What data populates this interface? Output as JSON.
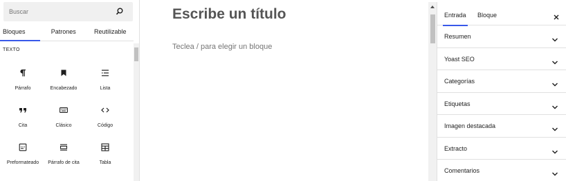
{
  "inserter": {
    "search": {
      "placeholder": "Buscar"
    },
    "tabs": [
      {
        "label": "Bloques",
        "active": true
      },
      {
        "label": "Patrones",
        "active": false
      },
      {
        "label": "Reutilizable",
        "active": false
      }
    ],
    "section": "TEXTO",
    "blocks": [
      {
        "label": "Párrafo",
        "icon": "paragraph-icon"
      },
      {
        "label": "Encabezado",
        "icon": "bookmark-icon"
      },
      {
        "label": "Lista",
        "icon": "list-icon"
      },
      {
        "label": "Cita",
        "icon": "quote-icon"
      },
      {
        "label": "Clásico",
        "icon": "keyboard-icon"
      },
      {
        "label": "Código",
        "icon": "code-icon"
      },
      {
        "label": "Preformateado",
        "icon": "preformatted-icon"
      },
      {
        "label": "Párrafo de cita",
        "icon": "pullquote-icon"
      },
      {
        "label": "Tabla",
        "icon": "table-icon"
      }
    ]
  },
  "editor": {
    "title_placeholder": "Escribe un título",
    "appender_placeholder": "Teclea / para elegir un bloque"
  },
  "settings": {
    "tabs": [
      {
        "label": "Entrada",
        "active": true
      },
      {
        "label": "Bloque",
        "active": false
      }
    ],
    "panels": [
      "Resumen",
      "Yoast SEO",
      "Categorías",
      "Etiquetas",
      "Imagen destacada",
      "Extracto",
      "Comentarios"
    ]
  },
  "colors": {
    "accent": "#3858e9",
    "text": "#1e1e1e",
    "muted": "#757575",
    "border": "#e0e0e0"
  }
}
